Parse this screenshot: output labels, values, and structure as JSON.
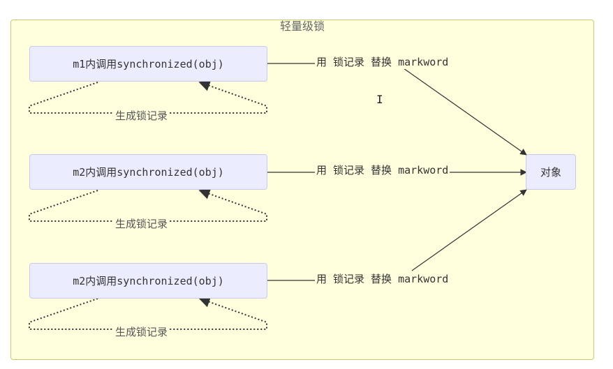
{
  "cluster": {
    "title": "轻量级锁"
  },
  "nodes": [
    {
      "id": "m1",
      "label": "m1内调用synchronized(obj)"
    },
    {
      "id": "m2a",
      "label": "m2内调用synchronized(obj)"
    },
    {
      "id": "m2b",
      "label": "m2内调用synchronized(obj)"
    },
    {
      "id": "object",
      "label": "对象"
    }
  ],
  "edges": [
    {
      "from": "m1",
      "to": "object",
      "label": "用 锁记录 替换 markword"
    },
    {
      "from": "m2a",
      "to": "object",
      "label": "用 锁记录 替换 markword"
    },
    {
      "from": "m2b",
      "to": "object",
      "label": "用 锁记录 替换 markword"
    }
  ],
  "loops": [
    {
      "node": "m1",
      "label": "生成锁记录"
    },
    {
      "node": "m2a",
      "label": "生成锁记录"
    },
    {
      "node": "m2b",
      "label": "生成锁记录"
    }
  ],
  "colors": {
    "cluster_fill": "#ffffde",
    "cluster_border": "#c9c978",
    "node_fill": "#ececff",
    "node_border": "#c9c9ef",
    "edge": "#333333"
  }
}
